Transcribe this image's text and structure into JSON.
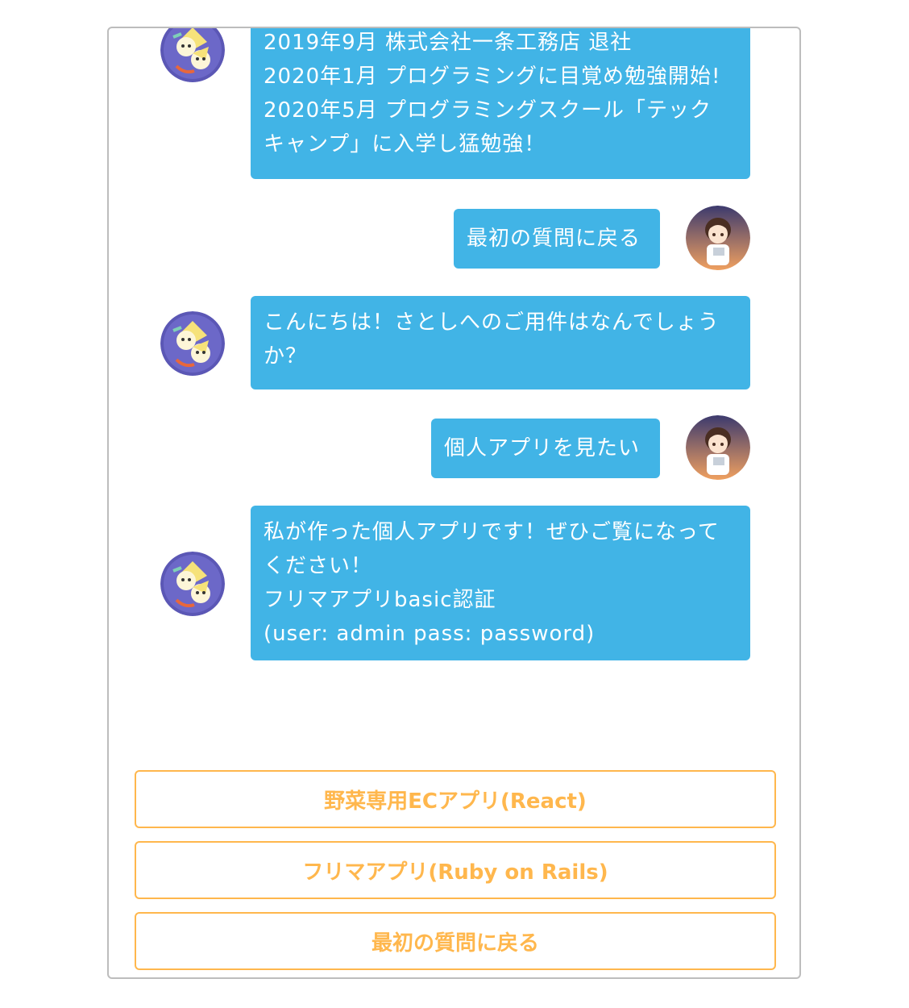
{
  "chat": {
    "messages": [
      {
        "sender": "bot",
        "lines": [
          "2019年9月 株式会社一条工務店 退社",
          "2020年1月 プログラミングに目覚め勉強開始!",
          "2020年5月 プログラミングスクール「テック",
          "キャンプ」に入学し猛勉強！"
        ]
      },
      {
        "sender": "user",
        "lines": [
          "最初の質問に戻る"
        ]
      },
      {
        "sender": "bot",
        "lines": [
          "こんにちは！さとしへのご用件はなんでしょう",
          "か？"
        ]
      },
      {
        "sender": "user",
        "lines": [
          "個人アプリを見たい"
        ]
      },
      {
        "sender": "bot",
        "lines": [
          "私が作った個人アプリです！ぜひご覧になって",
          "ください！",
          "フリマアプリbasic認証",
          "(user: admin pass: password)"
        ]
      }
    ]
  },
  "options": [
    {
      "label": "野菜専用ECアプリ(React)"
    },
    {
      "label": "フリマアプリ(Ruby on Rails)"
    },
    {
      "label": "最初の質問に戻る"
    }
  ],
  "colors": {
    "bubble": "#41b4e6",
    "option_border": "#ffb74d",
    "window_border": "#bdbdbd"
  },
  "icons": {
    "bot_avatar": "bot-avatar-icon",
    "user_avatar": "user-avatar-icon"
  }
}
